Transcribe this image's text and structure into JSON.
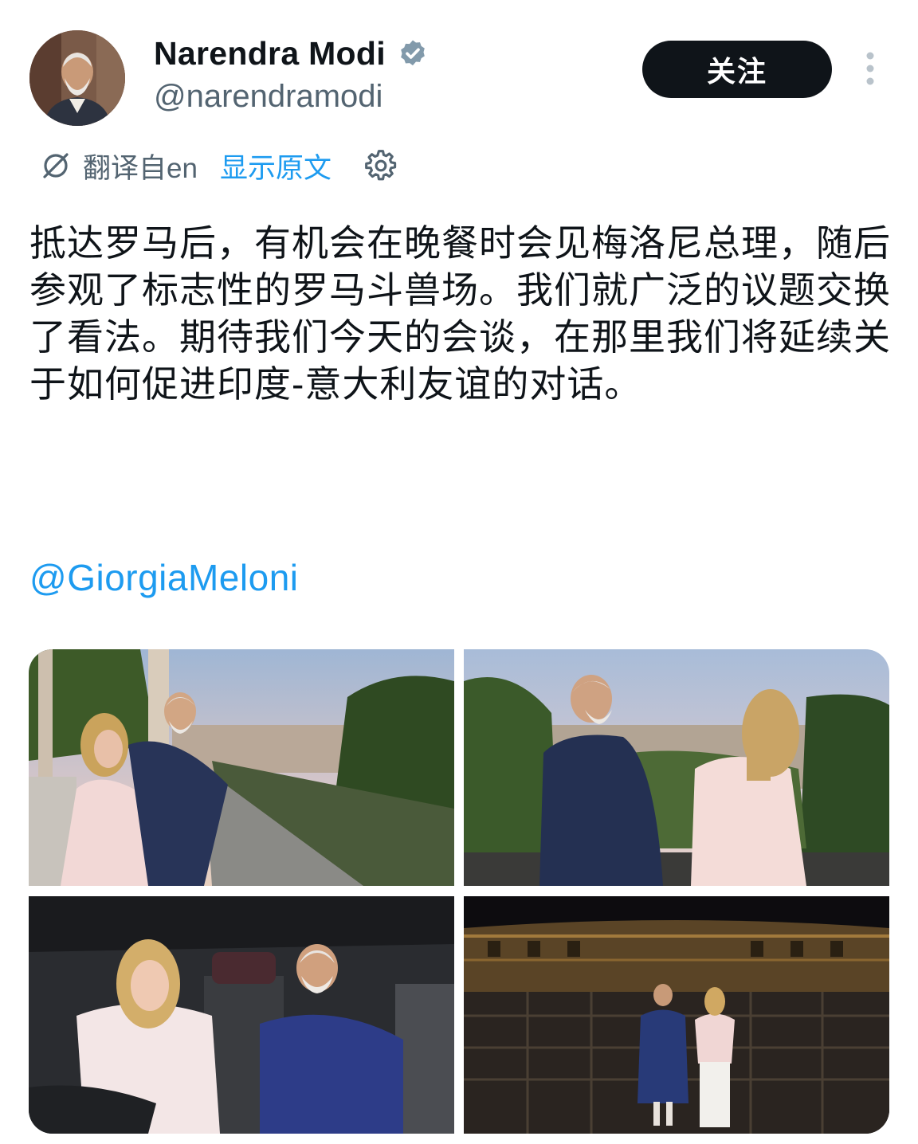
{
  "author": {
    "display_name": "Narendra Modi",
    "handle": "@narendramodi",
    "verified_icon": "verified-badge-icon",
    "verified_color": "#829aab"
  },
  "actions": {
    "follow_label": "关注",
    "more_icon": "more-vertical-icon"
  },
  "translation": {
    "translated_from": "翻译自en",
    "show_original": "显示原文",
    "translate_icon": "translate-icon",
    "settings_icon": "gear-icon"
  },
  "tweet": {
    "text": "抵达罗马后，有机会在晚餐时会见梅洛尼总理，随后参观了标志性的罗马斗兽场。我们就广泛的议题交换了看法。期待我们今天的会谈，在那里我们将延续关于如何促进印度-意大利友谊的对话。",
    "mention": "@GiorgiaMeloni"
  },
  "colors": {
    "text": "#0f1419",
    "secondary": "#536471",
    "link": "#1d9bf0",
    "button_bg": "#0f1419"
  }
}
